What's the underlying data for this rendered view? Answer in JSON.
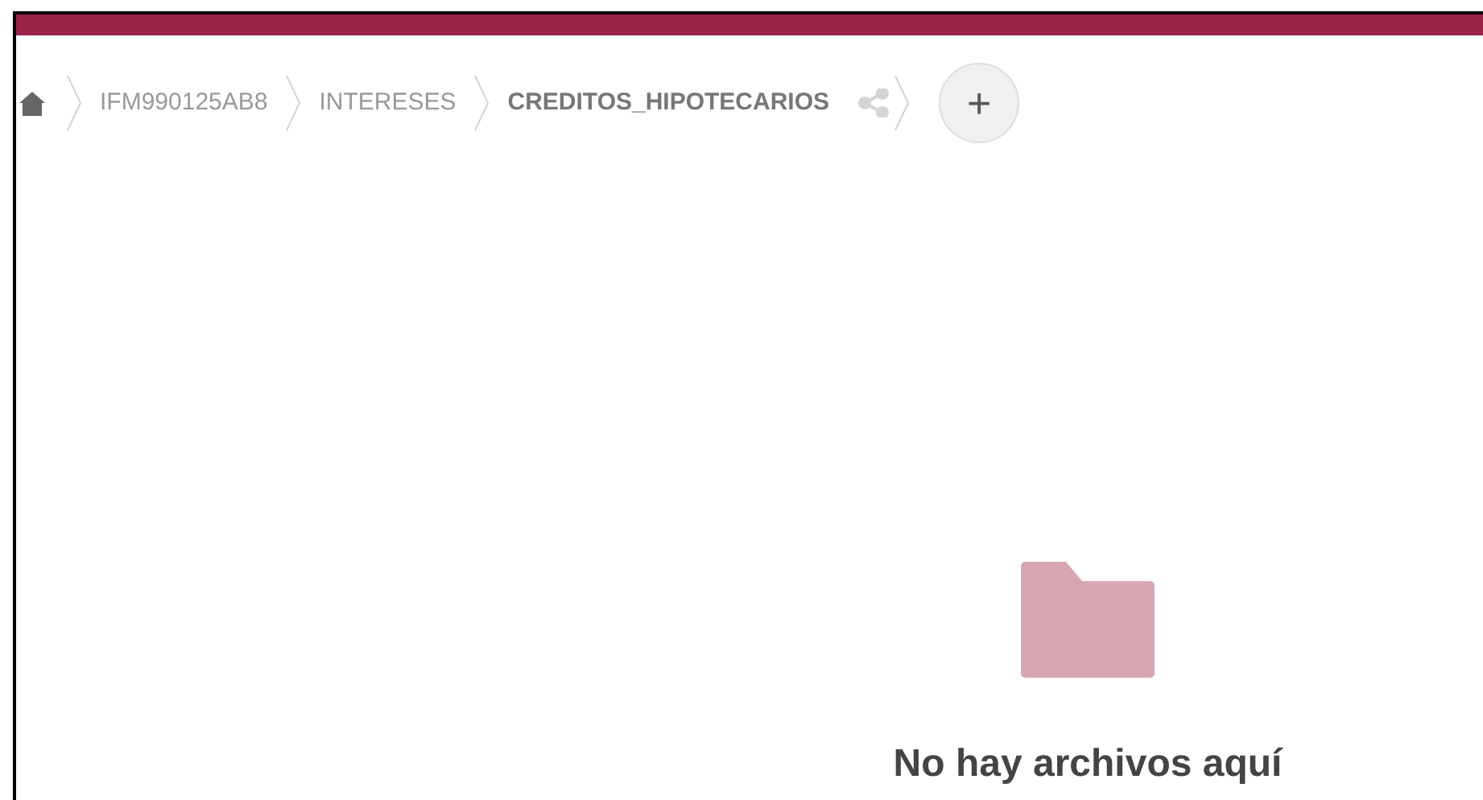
{
  "breadcrumbs": [
    {
      "label": "IFM990125AB8",
      "selected": false
    },
    {
      "label": "INTERESES",
      "selected": false
    },
    {
      "label": "CREDITOS_HIPOTECARIOS",
      "selected": true
    }
  ],
  "add_button": {
    "label": "+"
  },
  "empty_state": {
    "message": "No hay archivos aquí"
  }
}
